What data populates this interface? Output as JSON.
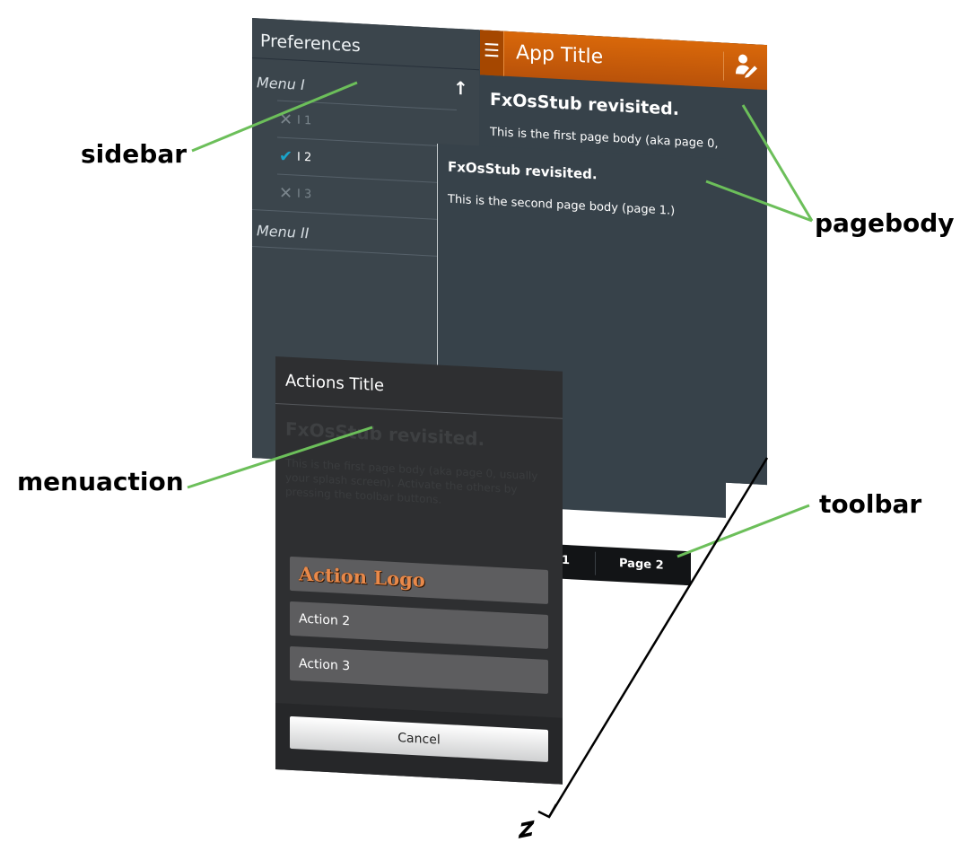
{
  "sidebar": {
    "title": "Preferences",
    "menu1": "Menu I",
    "items": [
      {
        "label": "I 1",
        "state": "unchecked"
      },
      {
        "label": "I 2",
        "state": "checked"
      },
      {
        "label": "I 3",
        "state": "unchecked"
      }
    ],
    "menu2": "Menu II"
  },
  "page1": {
    "app_title": "App Title",
    "heading": "FxOsStub revisited.",
    "body": "This is the first page body (aka page 0,"
  },
  "page2": {
    "heading": "FxOsStub revisited.",
    "body": "This is the second page body (page 1.)"
  },
  "toolbar": {
    "item1": "1",
    "item2": "Page 2"
  },
  "actions": {
    "title": "Actions Title",
    "ghost_heading": "FxOsStub revisited.",
    "ghost_body": "This is the first page body (aka page 0, usually your splash screen). Activate the others by pressing the toolbar buttons.",
    "logo": "Action Logo",
    "action2": "Action 2",
    "action3": "Action 3",
    "cancel": "Cancel"
  },
  "callouts": {
    "sidebar": "sidebar",
    "pagebody": "pagebody",
    "menuaction": "menuaction",
    "toolbar": "toolbar",
    "z_axis": "z"
  },
  "colors": {
    "panel": "#37424a",
    "appbar": "#d9680a",
    "annotation_line": "#6cbf5a",
    "check": "#1aa3c9"
  }
}
